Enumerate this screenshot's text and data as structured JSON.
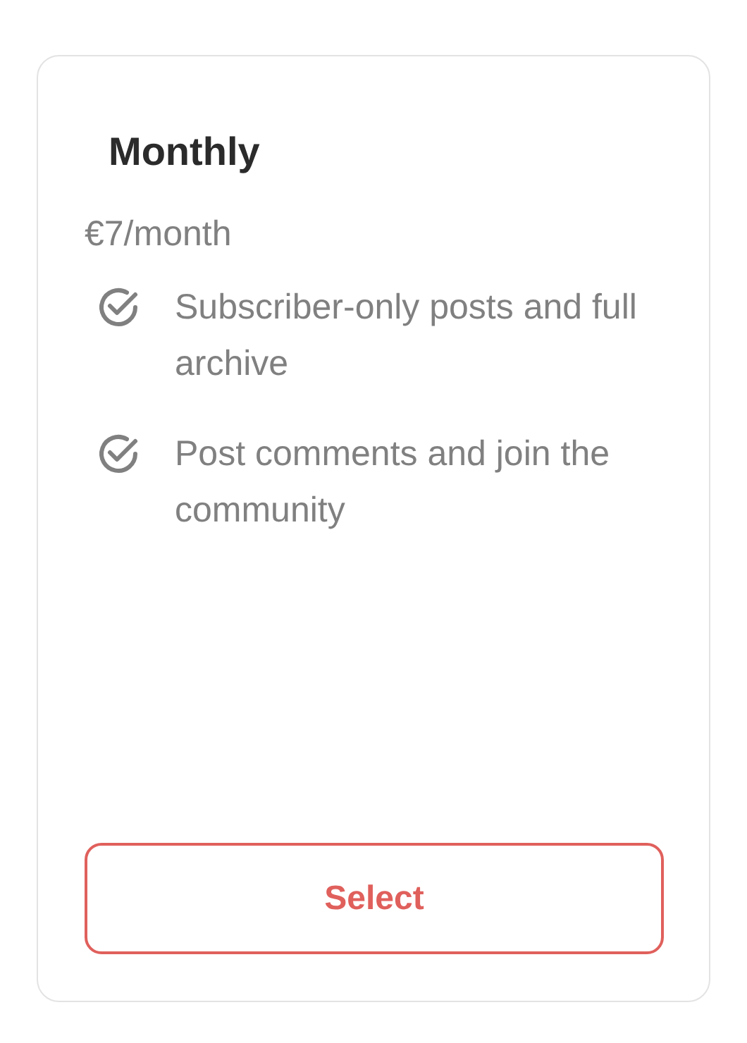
{
  "plan": {
    "title": "Monthly",
    "price": "€7/month",
    "features": [
      {
        "text": "Subscriber-only posts and full archive"
      },
      {
        "text": "Post comments and join the community"
      }
    ],
    "button": "Select"
  }
}
